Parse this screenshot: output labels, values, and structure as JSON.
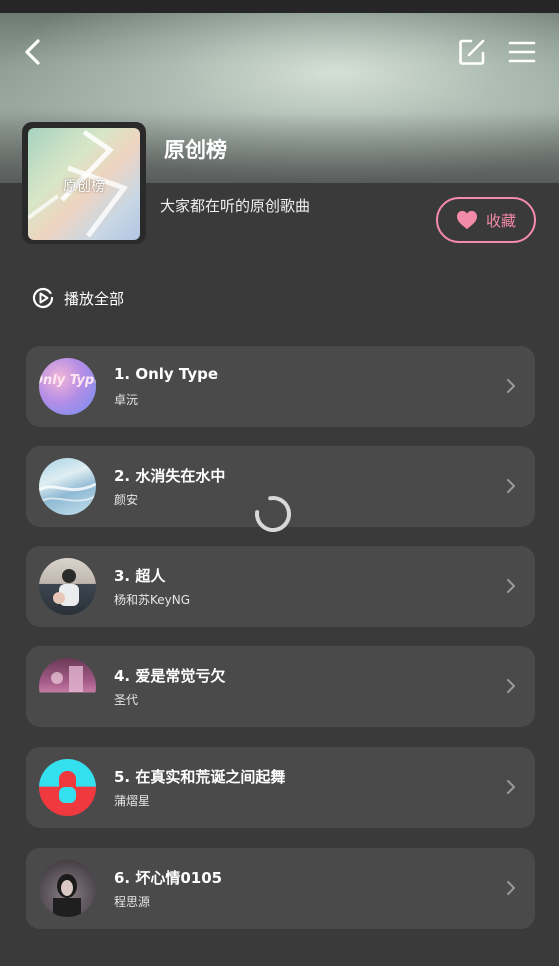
{
  "header": {
    "title": "原创榜",
    "description": "大家都在听的原创歌曲",
    "cover_text": "原创榜",
    "favorite_label": "收藏",
    "icons": {
      "back": "back-arrow-icon",
      "edit": "edit-icon",
      "menu": "menu-icon",
      "heart": "heart-icon"
    }
  },
  "play_all": {
    "label": "播放全部",
    "icon": "play-circle-icon"
  },
  "songs": [
    {
      "name": "1. Only Type",
      "artist": "卓沅",
      "thumb_text": "Only Type"
    },
    {
      "name": "2. 水消失在水中",
      "artist": "颜安"
    },
    {
      "name": "3. 超人",
      "artist": "杨和苏KeyNG"
    },
    {
      "name": "4. 爱是常觉亏欠",
      "artist": "圣代"
    },
    {
      "name": "5. 在真实和荒诞之间起舞",
      "artist": "蒲熠星"
    },
    {
      "name": "6. 坏心情0105",
      "artist": "程思源"
    }
  ],
  "colors": {
    "background": "#3a3a3a",
    "card": "#4a4a4a",
    "accent_pink": "#f28aa9"
  },
  "loading": true
}
